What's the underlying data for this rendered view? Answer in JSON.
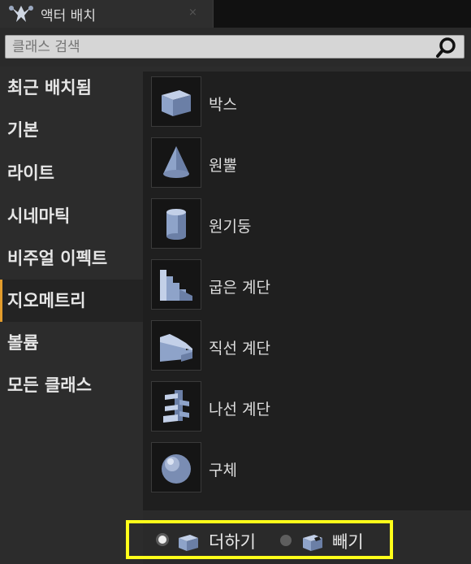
{
  "tab": {
    "title": "액터 배치",
    "close": "×",
    "icon": "place-actors-icon"
  },
  "search": {
    "placeholder": "클래스 검색"
  },
  "categories": [
    {
      "label": "최근 배치됨"
    },
    {
      "label": "기본"
    },
    {
      "label": "라이트"
    },
    {
      "label": "시네마틱"
    },
    {
      "label": "비주얼 이펙트"
    },
    {
      "label": "지오메트리",
      "active": true
    },
    {
      "label": "볼륨"
    },
    {
      "label": "모든 클래스"
    }
  ],
  "items": [
    {
      "label": "박스",
      "icon": "box-icon"
    },
    {
      "label": "원뿔",
      "icon": "cone-icon"
    },
    {
      "label": "원기둥",
      "icon": "cylinder-icon"
    },
    {
      "label": "굽은 계단",
      "icon": "curved-stair-icon"
    },
    {
      "label": "직선 계단",
      "icon": "linear-stair-icon"
    },
    {
      "label": "나선 계단",
      "icon": "spiral-stair-icon"
    },
    {
      "label": "구체",
      "icon": "sphere-icon"
    }
  ],
  "brush_mode": {
    "additive": {
      "label": "더하기",
      "selected": true
    },
    "subtractive": {
      "label": "빼기",
      "selected": false
    }
  },
  "colors": {
    "accent": "#e29c2c",
    "highlight_box": "#ffff1a",
    "shape": "#8ea3c9"
  }
}
